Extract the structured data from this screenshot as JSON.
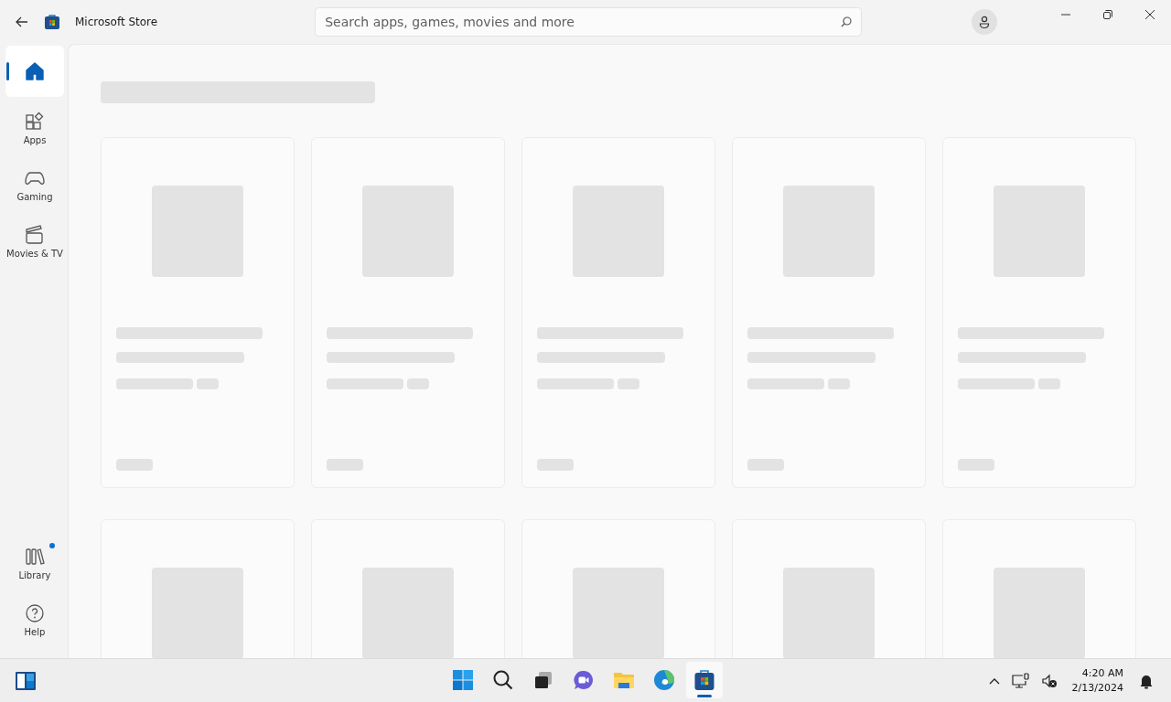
{
  "window": {
    "title": "Microsoft Store"
  },
  "search": {
    "placeholder": "Search apps, games, movies and more"
  },
  "nav": {
    "top": [
      {
        "kind": "home",
        "selected": true
      },
      {
        "kind": "apps",
        "label": "Apps",
        "selected": false
      },
      {
        "kind": "gaming",
        "label": "Gaming",
        "selected": false
      },
      {
        "kind": "movies",
        "label": "Movies & TV",
        "selected": false
      }
    ],
    "bottom": [
      {
        "kind": "library",
        "label": "Library",
        "selected": false,
        "badge": true
      },
      {
        "kind": "help",
        "label": "Help",
        "selected": false
      }
    ]
  },
  "content": {
    "loading": true,
    "rows": [
      {
        "cut_off": false,
        "cards": [
          {
            "kind": "skeleton"
          },
          {
            "kind": "skeleton"
          },
          {
            "kind": "skeleton"
          },
          {
            "kind": "skeleton"
          },
          {
            "kind": "skeleton"
          }
        ]
      },
      {
        "cut_off": true,
        "cards": [
          {
            "kind": "skeleton"
          },
          {
            "kind": "skeleton"
          },
          {
            "kind": "skeleton"
          },
          {
            "kind": "skeleton"
          },
          {
            "kind": "skeleton"
          }
        ]
      }
    ]
  },
  "taskbar": {
    "apps": [
      {
        "kind": "start",
        "active": false
      },
      {
        "kind": "search",
        "active": false
      },
      {
        "kind": "taskview",
        "active": false
      },
      {
        "kind": "chat",
        "active": false
      },
      {
        "kind": "folder",
        "active": false
      },
      {
        "kind": "edge",
        "active": false
      },
      {
        "kind": "store",
        "active": true
      }
    ],
    "tray": {
      "time": "4:20 AM",
      "date": "2/13/2024"
    }
  }
}
